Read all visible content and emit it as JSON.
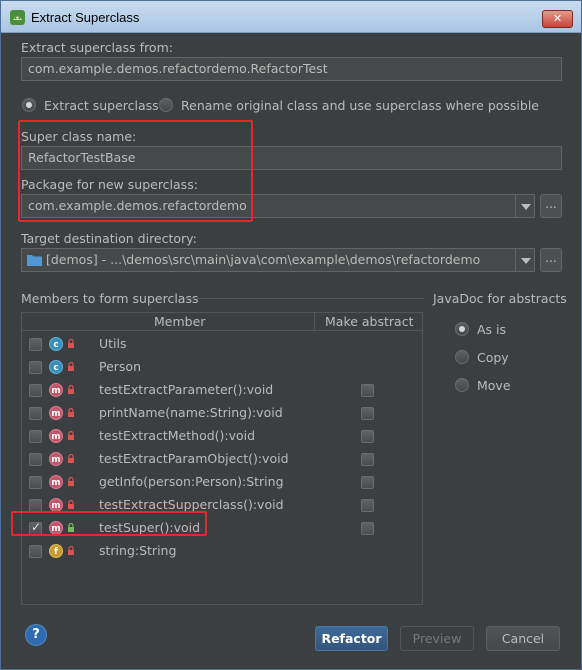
{
  "window": {
    "title": "Extract Superclass",
    "close_label": "✕"
  },
  "form": {
    "extract_from_label": "Extract superclass from:",
    "extract_from_value": "com.example.demos.refactordemo.RefactorTest",
    "mode_extract_label": "Extract superclass",
    "mode_rename_label": "Rename original class and use superclass where possible",
    "super_name_label": "Super class name:",
    "super_name_value": "RefactorTestBase",
    "package_label": "Package for new superclass:",
    "package_value": "com.example.demos.refactordemo",
    "target_dir_label": "Target destination directory:",
    "target_dir_value": "[demos] - ...\\demos\\src\\main\\java\\com\\example\\demos\\refactordemo",
    "browse_label": "..."
  },
  "members": {
    "section_label": "Members to form superclass",
    "col_member": "Member",
    "col_abstract": "Make abstract",
    "rows": [
      {
        "name": "Utils",
        "kind": "c",
        "checked": false,
        "abstract_box": false
      },
      {
        "name": "Person",
        "kind": "c",
        "checked": false,
        "abstract_box": false
      },
      {
        "name": "testExtractParameter():void",
        "kind": "m",
        "checked": false,
        "abstract_box": true
      },
      {
        "name": "printName(name:String):void",
        "kind": "m",
        "checked": false,
        "abstract_box": true
      },
      {
        "name": "testExtractMethod():void",
        "kind": "m",
        "checked": false,
        "abstract_box": true
      },
      {
        "name": "testExtractParamObject():void",
        "kind": "m",
        "checked": false,
        "abstract_box": true
      },
      {
        "name": "getInfo(person:Person):String",
        "kind": "m",
        "checked": false,
        "abstract_box": true
      },
      {
        "name": "testExtractSupperclass():void",
        "kind": "m",
        "checked": false,
        "abstract_box": true
      },
      {
        "name": "testSuper():void",
        "kind": "m",
        "checked": true,
        "abstract_box": true
      },
      {
        "name": "string:String",
        "kind": "f",
        "checked": false,
        "abstract_box": false
      }
    ]
  },
  "javadoc": {
    "section_label": "JavaDoc for abstracts",
    "options": [
      "As is",
      "Copy",
      "Move"
    ],
    "selected": "As is"
  },
  "footer": {
    "help_label": "?",
    "refactor_label": "Refactor",
    "preview_label": "Preview",
    "cancel_label": "Cancel"
  },
  "colors": {
    "highlight": "#e8272c",
    "primary_button": "#3e6a99"
  }
}
